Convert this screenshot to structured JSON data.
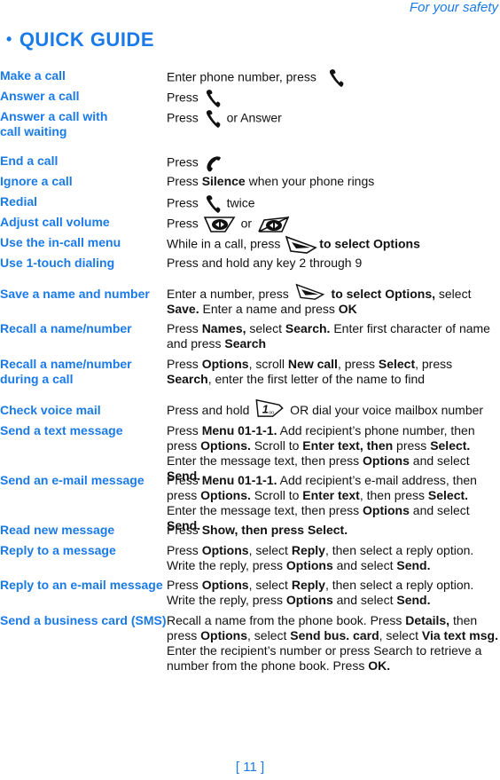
{
  "header": {
    "section": "For your safety"
  },
  "title": {
    "bullet": "•",
    "text": "QUICK GUIDE"
  },
  "icons": {
    "call": "call-key-icon",
    "end": "end-key-icon",
    "scroll_right": "scroll-right-volume-icon",
    "scroll_left": "scroll-left-volume-icon",
    "selection": "selection-key-icon",
    "voicemail": "one-key-voicemail-icon"
  },
  "rows": [
    {
      "term": "Make a call",
      "parts": [
        "Enter phone number, press "
      ]
    },
    {
      "term": "Answer a call",
      "parts": [
        "Press "
      ]
    },
    {
      "term": "Answer a call with\ncall waiting",
      "parts": [
        "Press ",
        " or Answer"
      ]
    },
    {
      "term": "End a call",
      "parts": [
        "Press "
      ]
    },
    {
      "term": "Ignore a call",
      "parts": [
        "Press ",
        "Silence",
        " when your phone rings"
      ]
    },
    {
      "term": "Redial",
      "parts": [
        "Press ",
        " twice"
      ]
    },
    {
      "term": "Adjust call volume",
      "parts": [
        "Press ",
        " or "
      ]
    },
    {
      "term": "Use the in-call menu",
      "parts": [
        "While in a call, press ",
        "to select Options"
      ]
    },
    {
      "term": "Use 1-touch dialing",
      "parts": [
        "Press and hold any key 2 through 9"
      ]
    },
    {
      "term": "Save a name and number",
      "parts": [
        "Enter a number, press ",
        " to select Options,",
        " select ",
        "Save.",
        " Enter a name and press ",
        "OK"
      ]
    },
    {
      "term": "Recall a name/number",
      "parts": [
        "Press ",
        "Names,",
        " select ",
        "Search.",
        " Enter first character of name and press ",
        "Search"
      ]
    },
    {
      "term": "Recall a name/number\nduring a call",
      "parts": [
        "Press ",
        "Options",
        ", scroll ",
        "New call",
        ", press ",
        "Select",
        ", press ",
        "Search",
        ", enter the first letter of the name to find"
      ]
    },
    {
      "term": "Check voice mail",
      "parts": [
        "Press and hold ",
        " OR dial your voice mailbox number"
      ]
    },
    {
      "term": "Send a text message",
      "parts": [
        "Press ",
        "Menu 01-1-1.",
        " Add recipient’s phone number, then press ",
        "Options.",
        " Scroll to ",
        "Enter text, then",
        " press ",
        "Select.",
        " Enter the message text, then press ",
        "Options",
        " and select ",
        "Send."
      ]
    },
    {
      "term": "Send an e-mail message",
      "parts": [
        "Press ",
        "Menu 01-1-1.",
        " Add recipient’s e-mail address, then press ",
        "Options.",
        " Scroll to ",
        "Enter text",
        ", then press ",
        "Select.",
        " Enter the message text, then press ",
        "Options",
        " and select ",
        "Send."
      ]
    },
    {
      "term": "Read new message",
      "parts": [
        "Press ",
        "Show, then press Select."
      ]
    },
    {
      "term": "Reply to a message",
      "parts": [
        "Press ",
        "Options",
        ", select ",
        "Reply",
        ", then select a reply option. Write the reply, press ",
        "Options",
        " and select ",
        "Send."
      ]
    },
    {
      "term": "Reply to an e-mail message",
      "parts": [
        "Press ",
        "Options",
        ", select ",
        "Reply",
        ", then select a reply option. Write the reply, press ",
        "Options",
        " and select ",
        "Send."
      ]
    },
    {
      "term": "Send a business card (SMS)",
      "parts": [
        "Recall a name from the phone book. Press ",
        "Details,",
        " then press ",
        "Options",
        ", select ",
        "Send bus. card",
        ", select ",
        "Via text msg.",
        " Enter the recipient’s number or press Search to retrieve a number from the phone book. Press ",
        "OK."
      ]
    }
  ],
  "footer": {
    "page": "[ 11 ]"
  }
}
